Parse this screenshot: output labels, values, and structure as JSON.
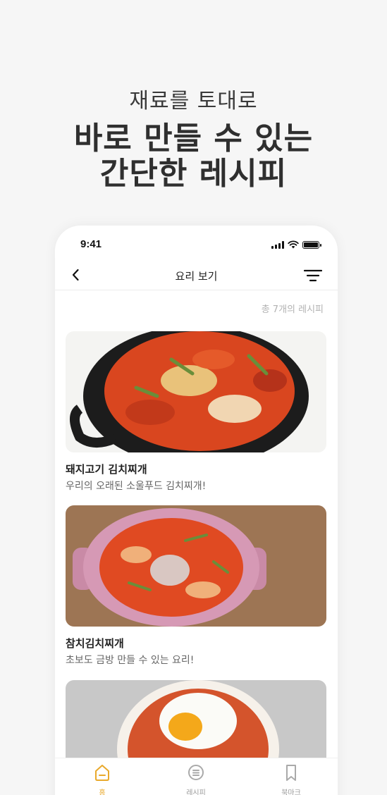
{
  "promo": {
    "subtitle": "재료를 토대로",
    "title_line1": "바로 만들 수 있는",
    "title_line2": "간단한 레시피"
  },
  "status_bar": {
    "time": "9:41"
  },
  "navbar": {
    "title": "요리 보기"
  },
  "recipe_count": "총 7개의 레시피",
  "recipes": [
    {
      "title": "돼지고기 김치찌개",
      "desc": "우리의 오래된 소울푸드 김치찌개!"
    },
    {
      "title": "참치김치찌개",
      "desc": "초보도 금방 만들 수 있는 요리!"
    },
    {
      "title": "",
      "desc": ""
    }
  ],
  "tabbar": {
    "items": [
      {
        "label": "홈",
        "icon": "home-icon",
        "active": true
      },
      {
        "label": "레시피",
        "icon": "recipe-list-icon",
        "active": false
      },
      {
        "label": "북마크",
        "icon": "bookmark-icon",
        "active": false
      }
    ]
  },
  "colors": {
    "accent": "#e9a92b",
    "background": "#f6f6f6",
    "card_bg": "#ffffff"
  }
}
